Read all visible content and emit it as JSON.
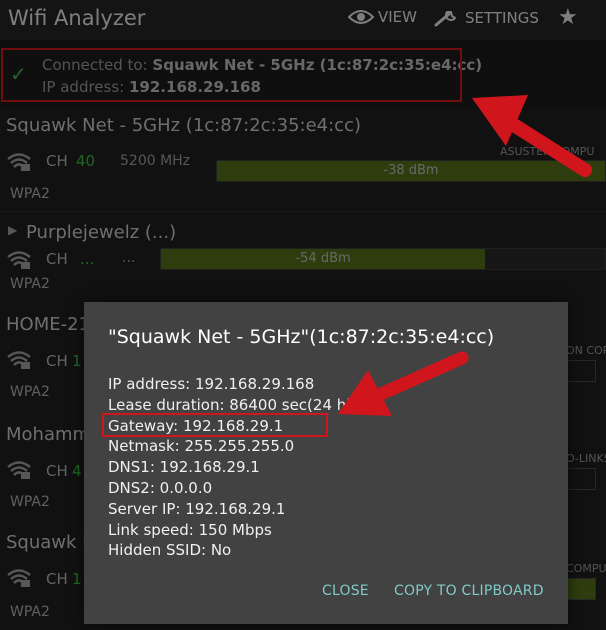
{
  "app": {
    "title": "Wifi Analyzer",
    "view_label": "VIEW",
    "settings_label": "SETTINGS"
  },
  "banner": {
    "connected_prefix": "Connected to: ",
    "connected_value": "Squawk Net - 5GHz (1c:87:2c:35:e4:cc)",
    "ip_prefix": "IP address: ",
    "ip_value": "192.168.29.168"
  },
  "access_points": [
    {
      "name": "Squawk Net - 5GHz (1c:87:2c:35:e4:cc)",
      "ch_label": "CH",
      "channel": "40",
      "freq": "5200 MHz",
      "encryption": "WPA2",
      "signal": "-38 dBm",
      "vendor": "ASUSTEK COMPU"
    },
    {
      "name": "Purplejewelz (...)",
      "ch_label": "CH",
      "channel": "...",
      "freq": "...",
      "encryption": "WPA2",
      "signal": "-54 dBm"
    },
    {
      "name": "HOME-21",
      "ch_label": "CH",
      "channel": "1",
      "encryption": "WPA2",
      "vendor": "ON COR"
    },
    {
      "name": "Mohamm",
      "ch_label": "CH",
      "channel": "4",
      "encryption": "WPA2",
      "vendor": "O-LINKS"
    },
    {
      "name": "Squawk N",
      "ch_label": "CH",
      "channel": "1",
      "encryption": "WPA2",
      "vendor": "COMPU"
    }
  ],
  "dialog": {
    "title": "\"Squawk Net - 5GHz\"(1c:87:2c:35:e4:cc)",
    "rows": [
      "IP address: 192.168.29.168",
      "Lease duration: 86400 sec(24 h)",
      "Gateway: 192.168.29.1",
      "Netmask: 255.255.255.0",
      "DNS1: 192.168.29.1",
      "DNS2: 0.0.0.0",
      "Server IP: 192.168.29.1",
      "Link speed: 150 Mbps",
      "Hidden SSID: No"
    ],
    "close_label": "CLOSE",
    "copy_label": "COPY TO CLIPBOARD"
  },
  "colors": {
    "annotation_red": "#d0161c",
    "signal_fill": "#55701a",
    "channel_green": "#3cba3c",
    "button_teal": "#80cbc4"
  }
}
